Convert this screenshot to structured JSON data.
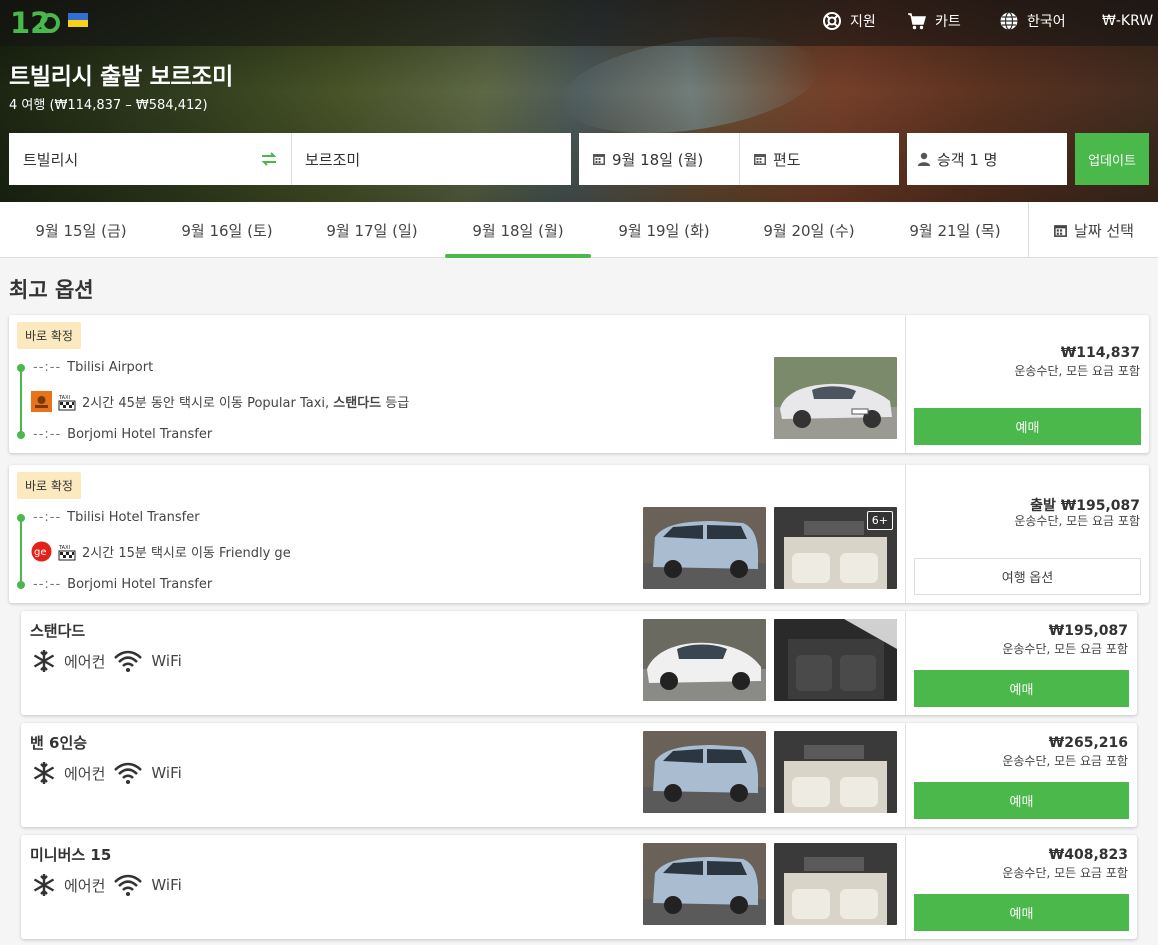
{
  "header": {
    "nav": {
      "support": "지원",
      "cart": "카트",
      "language": "한국어",
      "currency": "₩-KRW"
    },
    "title": "트빌리시 출발 보르조미",
    "subtitle": "4 여행 (₩114,837 – ₩584,412)"
  },
  "search": {
    "from": "트빌리시",
    "to": "보르조미",
    "date": "9월 18일 (월)",
    "trip_type": "편도",
    "passengers": "승객 1 명",
    "update_label": "업데이트"
  },
  "dates": {
    "tabs": [
      "9월 15일 (금)",
      "9월 16일 (토)",
      "9월 17일 (일)",
      "9월 18일 (월)",
      "9월 19일 (화)",
      "9월 20일 (수)",
      "9월 21일 (목)"
    ],
    "active_index": 3,
    "pick_label": "날짜 선택"
  },
  "section_title": "최고 옵션",
  "results": [
    {
      "badge": "바로 확정",
      "depart_time": "--:--",
      "depart_place": "Tbilisi Airport",
      "ride_pre": "2시간 45분 동안 택시로 이동 Popular Taxi, ",
      "ride_bold": "스탠다드",
      "ride_post": " 등급",
      "arrive_time": "--:--",
      "arrive_place": "Borjomi Hotel Transfer",
      "price": "₩114,837",
      "price_note": "운송수단, 모든 요금 포함",
      "button": "예매"
    },
    {
      "badge": "바로 확정",
      "depart_time": "--:--",
      "depart_place": "Tbilisi Hotel Transfer",
      "ride": "2시간 15분 택시로 이동 Friendly ge",
      "arrive_time": "--:--",
      "arrive_place": "Borjomi Hotel Transfer",
      "photo_more": "6+",
      "price": "출발 ₩195,087",
      "price_note": "운송수단, 모든 요금 포함",
      "button": "여행 옵션",
      "operator_logo": "ge"
    }
  ],
  "classes": [
    {
      "name": "스탠다드",
      "amenity_ac": "에어컨",
      "amenity_wifi": "WiFi",
      "price": "₩195,087",
      "price_note": "운송수단, 모든 요금 포함",
      "button": "예매"
    },
    {
      "name": "밴 6인승",
      "amenity_ac": "에어컨",
      "amenity_wifi": "WiFi",
      "price": "₩265,216",
      "price_note": "운송수단, 모든 요금 포함",
      "button": "예매"
    },
    {
      "name": "미니버스 15",
      "amenity_ac": "에어컨",
      "amenity_wifi": "WiFi",
      "price": "₩408,823",
      "price_note": "운송수단, 모든 요금 포함",
      "button": "예매"
    }
  ],
  "colors": {
    "accent": "#4ab84a",
    "badge_bg": "#fde9bf"
  }
}
